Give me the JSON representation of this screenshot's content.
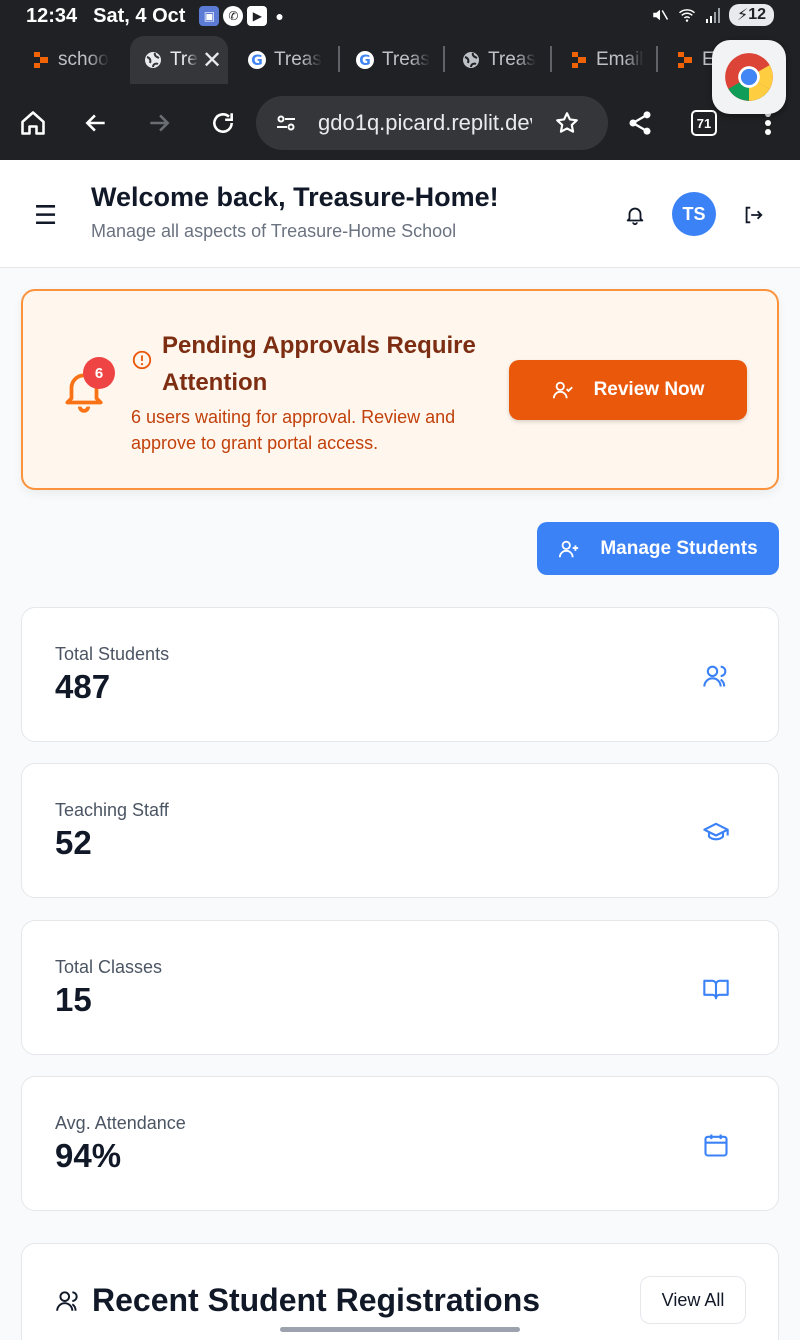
{
  "status_bar": {
    "time": "12:34",
    "date": "Sat, 4 Oct",
    "battery": "12",
    "icons": [
      "notification-app-icon",
      "whatsapp-icon",
      "youtube-icon",
      "dot-icon",
      "mute-icon",
      "wifi-icon",
      "signal-icon",
      "battery-icon"
    ]
  },
  "browser": {
    "tabs": [
      {
        "label": "schoo",
        "icon": "replit-icon",
        "active": false
      },
      {
        "label": "Tre",
        "icon": "globe-icon",
        "active": true
      },
      {
        "label": "Treas",
        "icon": "google-icon",
        "active": false
      },
      {
        "label": "Treas",
        "icon": "google-icon",
        "active": false
      },
      {
        "label": "Treas",
        "icon": "globe-icon",
        "active": false
      },
      {
        "label": "Email",
        "icon": "replit-icon",
        "active": false
      },
      {
        "label": "En",
        "icon": "replit-icon",
        "active": false
      }
    ],
    "url": "gdo1q.picard.replit.dev",
    "tab_count": "71"
  },
  "header": {
    "title": "Welcome back, Treasure-Home!",
    "subtitle": "Manage all aspects of Treasure-Home School",
    "avatar_initials": "TS"
  },
  "banner": {
    "title": "Pending Approvals Require Attention",
    "text": "6 users waiting for approval. Review and approve to grant portal access.",
    "count": "6",
    "button_label": "Review Now"
  },
  "actions": {
    "manage_students_label": "Manage Students"
  },
  "stats": [
    {
      "label": "Total Students",
      "value": "487",
      "icon": "users-icon"
    },
    {
      "label": "Teaching Staff",
      "value": "52",
      "icon": "graduation-cap-icon"
    },
    {
      "label": "Total Classes",
      "value": "15",
      "icon": "book-open-icon"
    },
    {
      "label": "Avg. Attendance",
      "value": "94%",
      "icon": "calendar-icon"
    }
  ],
  "recent": {
    "title": "Recent Student Registrations",
    "view_all_label": "View All"
  },
  "colors": {
    "primary": "#3b82f6",
    "warning_bg": "#fff7ed",
    "warning_border": "#fb923c",
    "warning_button": "#ea580c",
    "badge": "#ef4444"
  }
}
